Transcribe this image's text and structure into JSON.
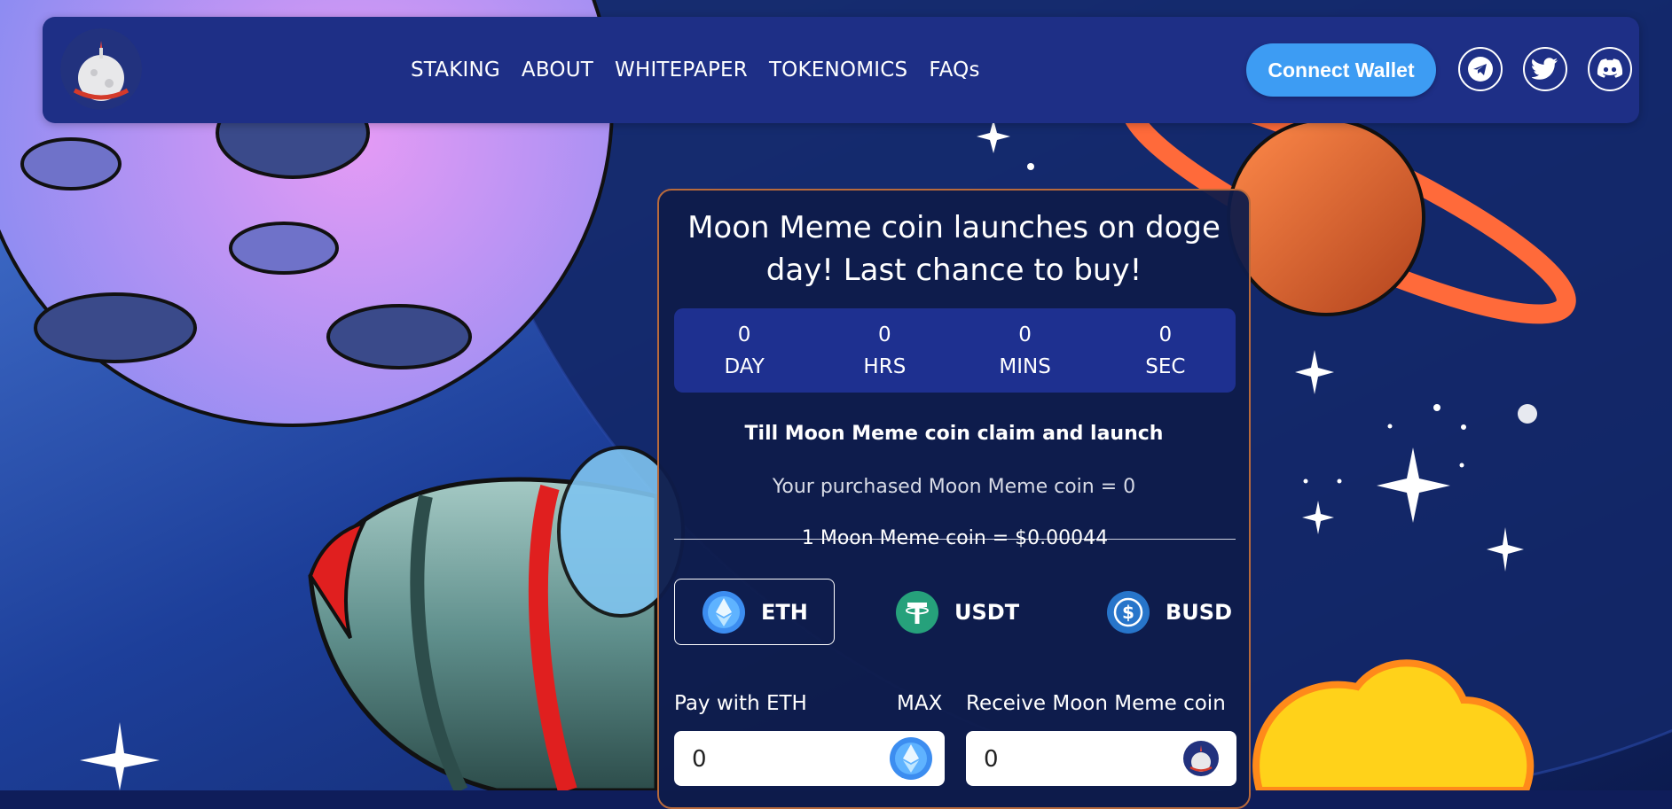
{
  "nav": {
    "items": [
      "STAKING",
      "ABOUT",
      "WHITEPAPER",
      "TOKENOMICS",
      "FAQs"
    ],
    "connect_label": "Connect Wallet",
    "socials": [
      "telegram-icon",
      "twitter-icon",
      "discord-icon"
    ]
  },
  "presale": {
    "title": "Moon Meme coin launches on doge day! Last chance to buy!",
    "countdown": [
      {
        "value": "0",
        "unit": "DAY"
      },
      {
        "value": "0",
        "unit": "HRS"
      },
      {
        "value": "0",
        "unit": "MINS"
      },
      {
        "value": "0",
        "unit": "SEC"
      }
    ],
    "till_text": "Till Moon Meme coin claim and launch",
    "purchased_text": "Your purchased Moon Meme coin = 0",
    "rate_text": "1 Moon Meme coin = $0.00044",
    "tokens": [
      {
        "label": "ETH",
        "icon": "eth-icon",
        "color": "#3c8df0",
        "selected": true
      },
      {
        "label": "USDT",
        "icon": "usdt-icon",
        "color": "#26a17b",
        "selected": false
      },
      {
        "label": "BUSD",
        "icon": "busd-icon",
        "color": "#2775ca",
        "selected": false
      }
    ],
    "pay_label": "Pay with ETH",
    "max_label": "MAX",
    "receive_label": "Receive Moon Meme coin",
    "pay_value": "0",
    "receive_value": "0"
  },
  "colors": {
    "header_bg": "#1e2f86",
    "card_bg": "#0e1c4a",
    "card_border": "#b86a3c",
    "accent_button": "#3d9cf3",
    "timer_bg": "#1e3090"
  }
}
